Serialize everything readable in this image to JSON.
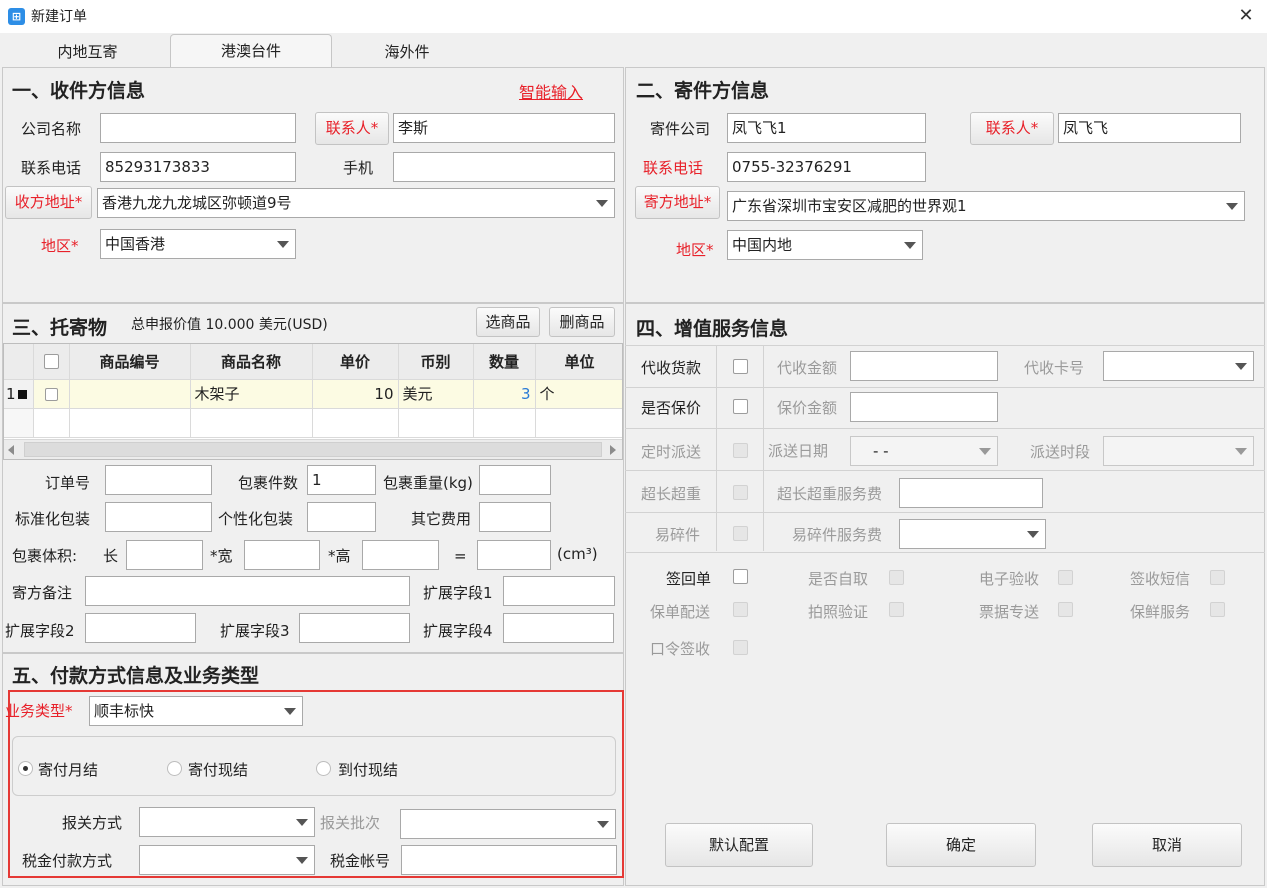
{
  "window": {
    "title": "新建订单"
  },
  "tabs": [
    {
      "label": "内地互寄"
    },
    {
      "label": "港澳台件"
    },
    {
      "label": "海外件"
    }
  ],
  "recipient": {
    "section_title": "一、收件方信息",
    "smart_input": "智能输入",
    "company_label": "公司名称",
    "company_value": "",
    "contact_btn": "联系人*",
    "contact_value": "李斯",
    "phone_label": "联系电话",
    "phone_value": "85293173833",
    "mobile_label": "手机",
    "mobile_value": "",
    "address_btn": "收方地址*",
    "address_value": "香港九龙九龙城区弥顿道9号",
    "region_label": "地区*",
    "region_value": "中国香港"
  },
  "sender": {
    "section_title": "二、寄件方信息",
    "company_label": "寄件公司",
    "company_value": "凤飞飞1",
    "contact_btn": "联系人*",
    "contact_value": "凤飞飞",
    "phone_label": "联系电话",
    "phone_value": "0755-32376291",
    "address_btn": "寄方地址*",
    "address_value": "广东省深圳市宝安区减肥的世界观1",
    "region_label": "地区*",
    "region_value": "中国内地"
  },
  "goods": {
    "section_title": "三、托寄物",
    "declared": "总申报价值 10.000 美元(USD)",
    "select_btn": "选商品",
    "delete_btn": "删商品",
    "columns": [
      "商品编号",
      "商品名称",
      "单价",
      "币别",
      "数量",
      "单位"
    ],
    "rows": [
      {
        "index": "1",
        "code": "",
        "name": "木架子",
        "price": "10",
        "currency": "美元",
        "qty": "3",
        "unit": "个"
      }
    ]
  },
  "package": {
    "order_no_label": "订单号",
    "count_label": "包裹件数",
    "count_value": "1",
    "weight_label": "包裹重量(kg)",
    "std_pack_label": "标准化包装",
    "custom_pack_label": "个性化包装",
    "other_fee_label": "其它费用",
    "volume_label": "包裹体积:",
    "length_label": "长",
    "width_label": "*宽",
    "height_label": "*高",
    "equals": "=",
    "unit": "(cm³)",
    "remark_label": "寄方备注",
    "ext1_label": "扩展字段1",
    "ext2_label": "扩展字段2",
    "ext3_label": "扩展字段3",
    "ext4_label": "扩展字段4"
  },
  "services": {
    "section_title": "四、增值服务信息",
    "cod_label": "代收货款",
    "cod_amount_label": "代收金额",
    "cod_card_label": "代收卡号",
    "insure_label": "是否保价",
    "insure_amount_label": "保价金额",
    "scheduled_label": "定时派送",
    "delivery_date_label": "派送日期",
    "delivery_date_value": "-   -",
    "delivery_time_label": "派送时段",
    "oversize_label": "超长超重",
    "oversize_fee_label": "超长超重服务费",
    "fragile_label": "易碎件",
    "fragile_fee_label": "易碎件服务费",
    "options": [
      "签回单",
      "是否自取",
      "电子验收",
      "签收短信",
      "保单配送",
      "拍照验证",
      "票据专送",
      "保鲜服务",
      "口令签收"
    ]
  },
  "payment": {
    "section_title": "五、付款方式信息及业务类型",
    "biz_type_label": "业务类型*",
    "biz_type_value": "顺丰标快",
    "pay_options": [
      "寄付月结",
      "寄付现结",
      "到付现结"
    ],
    "selected_pay": "寄付月结",
    "customs_label": "报关方式",
    "customs_batch_label": "报关批次",
    "tax_pay_label": "税金付款方式",
    "tax_account_label": "税金帐号"
  },
  "actions": {
    "default_config": "默认配置",
    "confirm": "确定",
    "cancel": "取消"
  },
  "colors": {
    "required": "#e8212a",
    "highlight_border": "#e53935",
    "selected_row": "#fcfbe3",
    "link": "#e8212a"
  }
}
